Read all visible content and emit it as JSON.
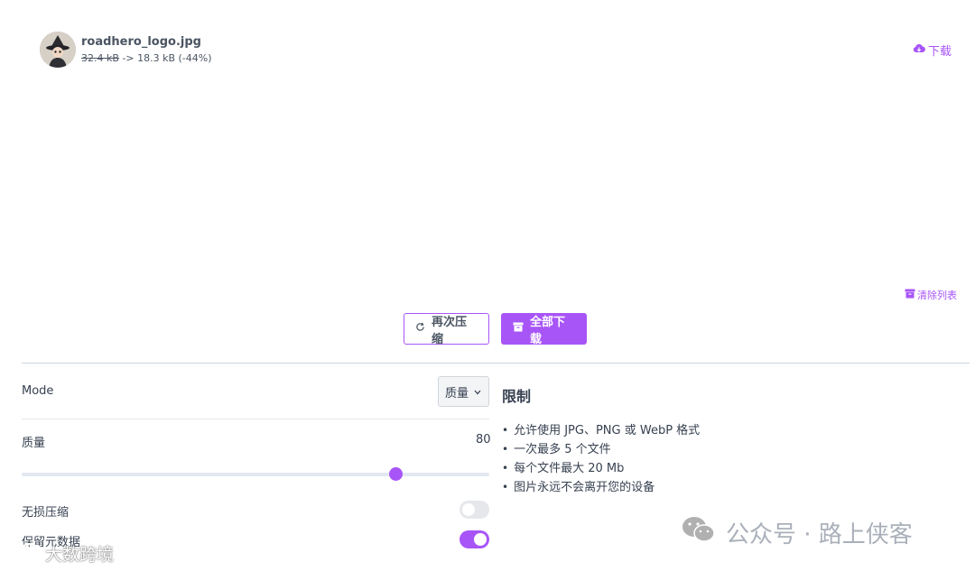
{
  "file": {
    "name": "roadhero_logo.jpg",
    "old_size": "32.4 kB",
    "new_size": "-> 18.3 kB (-44%)",
    "download_label": "下载"
  },
  "clear_label": "清除列表",
  "buttons": {
    "recompress": "再次压缩",
    "download_all": "全部下载"
  },
  "settings": {
    "mode_label": "Mode",
    "mode_value": "质量",
    "quality_label": "质量",
    "quality_value": "80",
    "quality_slider": {
      "min": 0,
      "max": 100,
      "value": 80
    },
    "lossless_label": "无损压缩",
    "lossless_on": false,
    "keep_meta_label": "保留元数据",
    "keep_meta_on": true
  },
  "limits": {
    "title": "限制",
    "items": [
      "允许使用 JPG、PNG 或 WebP 格式",
      "一次最多 5 个文件",
      "每个文件最大 20 Mb",
      "图片永远不会离开您的设备"
    ]
  },
  "watermark": {
    "right_text": "公众号 · 路上侠客",
    "left_text": "大数跨境"
  },
  "colors": {
    "accent": "#a855f7",
    "text": "#374151"
  }
}
